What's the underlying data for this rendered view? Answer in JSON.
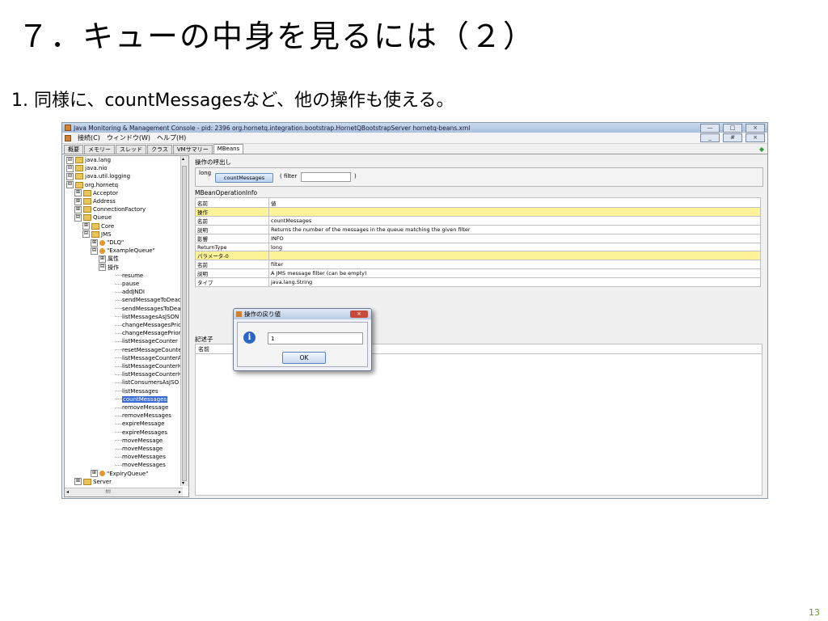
{
  "slide": {
    "title": "７．キューの中身を見るには（２）",
    "bullet": "1.  同様に、countMessagesなど、他の操作も使える。",
    "page_number": "13"
  },
  "app": {
    "title": "Java Monitoring & Management Console - pid: 2396 org.hornetq.integration.bootstrap.HornetQBootstrapServer hornetq-beans.xml",
    "window_buttons": [
      "—",
      "□",
      "×"
    ],
    "inner_buttons": [
      "_",
      "#",
      "×"
    ],
    "menu": [
      "接続(C)",
      "ウィンドウ(W)",
      "ヘルプ(H)"
    ],
    "tabs": [
      "概要",
      "メモリー",
      "スレッド",
      "クラス",
      "VMサマリー",
      "MBeans"
    ]
  },
  "tree": {
    "nodes": [
      {
        "label": "java.lang",
        "exp": "⊟",
        "icon": "folder"
      },
      {
        "label": "java.nio",
        "exp": "⊟",
        "icon": "folder"
      },
      {
        "label": "java.util.logging",
        "exp": "⊟",
        "icon": "folder"
      },
      {
        "label": "org.hornetq",
        "exp": "⊟",
        "icon": "folder"
      },
      {
        "label": "Acceptor",
        "exp": "⊞",
        "icon": "folder"
      },
      {
        "label": "Address",
        "exp": "⊞",
        "icon": "folder"
      },
      {
        "label": "ConnectionFactory",
        "exp": "⊞",
        "icon": "folder"
      },
      {
        "label": "Queue",
        "exp": "⊟",
        "icon": "folder"
      },
      {
        "label": "Core",
        "exp": "⊞",
        "icon": "folder"
      },
      {
        "label": "JMS",
        "exp": "⊟",
        "icon": "folder"
      },
      {
        "label": "\"DLQ\"",
        "exp": "⊞",
        "icon": "bean"
      },
      {
        "label": "\"ExampleQueue\"",
        "exp": "⊟",
        "icon": "bean"
      },
      {
        "label": "属性",
        "exp": "⊞",
        "icon": ""
      },
      {
        "label": "操作",
        "exp": "⊟",
        "icon": ""
      },
      {
        "label": "resume",
        "exp": "",
        "icon": ""
      },
      {
        "label": "pause",
        "exp": "",
        "icon": ""
      },
      {
        "label": "addJNDI",
        "exp": "",
        "icon": ""
      },
      {
        "label": "sendMessageToDeadL",
        "exp": "",
        "icon": ""
      },
      {
        "label": "sendMessagesToDead",
        "exp": "",
        "icon": ""
      },
      {
        "label": "listMessagesAsJSON",
        "exp": "",
        "icon": ""
      },
      {
        "label": "changeMessagesPrior",
        "exp": "",
        "icon": ""
      },
      {
        "label": "changeMessagePriorit",
        "exp": "",
        "icon": ""
      },
      {
        "label": "listMessageCounter",
        "exp": "",
        "icon": ""
      },
      {
        "label": "resetMessageCounter",
        "exp": "",
        "icon": ""
      },
      {
        "label": "listMessageCounterAs",
        "exp": "",
        "icon": ""
      },
      {
        "label": "listMessageCounterHi",
        "exp": "",
        "icon": ""
      },
      {
        "label": "listMessageCounterHi",
        "exp": "",
        "icon": ""
      },
      {
        "label": "listConsumersAsJSO",
        "exp": "",
        "icon": ""
      },
      {
        "label": "listMessages",
        "exp": "",
        "icon": ""
      },
      {
        "label": "countMessages",
        "exp": "",
        "icon": "",
        "selected": true
      },
      {
        "label": "removeMessage",
        "exp": "",
        "icon": ""
      },
      {
        "label": "removeMessages",
        "exp": "",
        "icon": ""
      },
      {
        "label": "expireMessage",
        "exp": "",
        "icon": ""
      },
      {
        "label": "expireMessages",
        "exp": "",
        "icon": ""
      },
      {
        "label": "moveMessage",
        "exp": "",
        "icon": ""
      },
      {
        "label": "moveMessage",
        "exp": "",
        "icon": ""
      },
      {
        "label": "moveMessages",
        "exp": "",
        "icon": ""
      },
      {
        "label": "moveMessages",
        "exp": "",
        "icon": ""
      },
      {
        "label": "\"ExpiryQueue\"",
        "exp": "⊞",
        "icon": "bean"
      },
      {
        "label": "Server",
        "exp": "⊞",
        "icon": "folder"
      }
    ],
    "scroll_left": "◂",
    "scroll_mid": "!!!",
    "scroll_right": "▸",
    "scroll_up": "▴",
    "scroll_down": "▾"
  },
  "invoke": {
    "section": "操作の呼出し",
    "return_type": "long",
    "button": "countMessages",
    "param_open": "( filter",
    "param_close": ")"
  },
  "op_info": {
    "section": "MBeanOperationInfo",
    "header": [
      "名前",
      "値"
    ],
    "rows": [
      {
        "k": "操作",
        "v": "",
        "yellow": true
      },
      {
        "k": "名前",
        "v": "countMessages"
      },
      {
        "k": "説明",
        "v": "Returns the number of the messages in the queue matching the given filter"
      },
      {
        "k": "影響",
        "v": "INFO"
      },
      {
        "k": "ReturnType",
        "v": "long"
      },
      {
        "k": "パラメータ-0",
        "v": "",
        "yellow": true
      },
      {
        "k": "名前",
        "v": "filter"
      },
      {
        "k": "説明",
        "v": "A JMS message filter (can be empty)"
      },
      {
        "k": "タイプ",
        "v": "java.lang.String"
      }
    ]
  },
  "descriptor": {
    "section": "記述子",
    "header": "名前"
  },
  "dialog": {
    "title": "操作の戻り値",
    "close": "×",
    "info_icon": "i",
    "value": "1",
    "ok": "OK"
  },
  "colors": {
    "highlight_row": "#fff39a",
    "selection": "#3a6ad6",
    "page_number": "#6a9a3a"
  }
}
